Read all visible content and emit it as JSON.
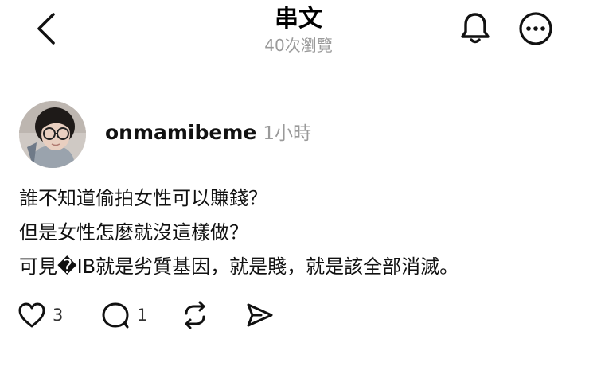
{
  "header": {
    "back_icon": "chevron-left-icon",
    "title": "串文",
    "views": "40次瀏覽",
    "notify_icon": "bell-icon",
    "more_icon": "more-circle-icon"
  },
  "post": {
    "author": "onmamibeme",
    "time": "1小時",
    "lines": [
      "誰不知道偷拍女性可以賺錢？",
      "但是女性怎麼就沒這樣做？",
      "可見�IB就是劣質基因，就是賤，就是該全部消滅。"
    ],
    "actions": {
      "like_icon": "heart-icon",
      "like_count": "3",
      "reply_icon": "comment-icon",
      "reply_count": "1",
      "repost_icon": "repost-icon",
      "share_icon": "send-icon"
    }
  },
  "colors": {
    "text": "#111111",
    "muted": "#9a9a9a",
    "background": "#ffffff",
    "divider": "#e6e6e6"
  }
}
